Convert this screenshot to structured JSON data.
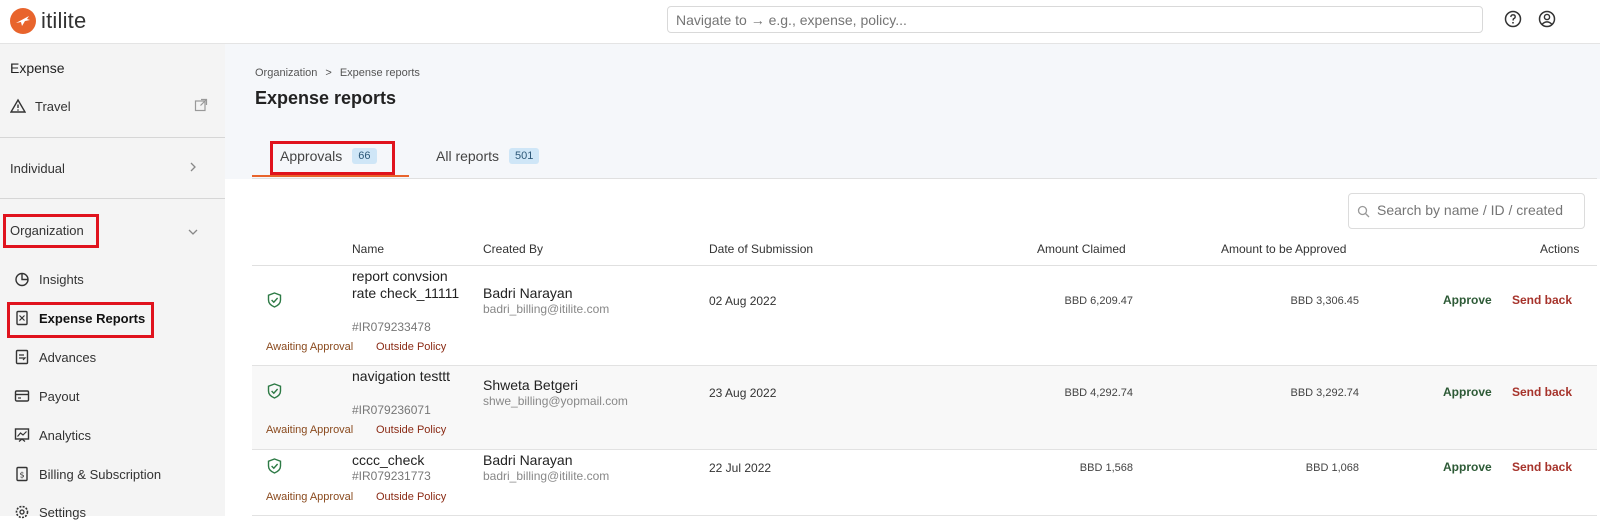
{
  "header": {
    "logo_text": "itilite",
    "nav_placeholder": "Navigate to → e.g., expense, policy...",
    "help_icon": "help-circle-icon",
    "user_icon": "user-circle-icon"
  },
  "sidebar": {
    "section_title": "Expense",
    "travel_label": "Travel",
    "individual_label": "Individual",
    "organization_label": "Organization",
    "items": [
      {
        "label": "Insights",
        "icon": "insights-pie-icon"
      },
      {
        "label": "Expense Reports",
        "icon": "expense-reports-icon"
      },
      {
        "label": "Advances",
        "icon": "advances-icon"
      },
      {
        "label": "Payout",
        "icon": "payout-card-icon"
      },
      {
        "label": "Analytics",
        "icon": "analytics-chart-icon"
      },
      {
        "label": "Billing & Subscription",
        "icon": "billing-icon"
      },
      {
        "label": "Settings",
        "icon": "settings-gear-icon"
      }
    ]
  },
  "main": {
    "breadcrumb": {
      "root": "Organization",
      "separator": ">",
      "current": "Expense reports"
    },
    "title": "Expense reports",
    "tabs": [
      {
        "label": "Approvals",
        "count": "66"
      },
      {
        "label": "All reports",
        "count": "501"
      }
    ],
    "search_placeholder": "Search by name / ID / created",
    "columns": [
      "Name",
      "Created By",
      "Date of Submission",
      "Amount Claimed",
      "Amount to be Approved",
      "Actions"
    ],
    "rows": [
      {
        "name": "report convsion rate check_11111",
        "id": "#IR079233478",
        "creator": "Badri Narayan",
        "email": "badri_billing@itilite.com",
        "date": "02 Aug 2022",
        "claimed": "BBD 6,209.47",
        "to_approve": "BBD 3,306.45",
        "status": "Awaiting Approval",
        "policy": "Outside Policy",
        "approve": "Approve",
        "send_back": "Send back"
      },
      {
        "name": "navigation testtt",
        "id": "#IR079236071",
        "creator": "Shweta Betgeri",
        "email": "shwe_billing@yopmail.com",
        "date": "23 Aug 2022",
        "claimed": "BBD 4,292.74",
        "to_approve": "BBD 3,292.74",
        "status": "Awaiting Approval",
        "policy": "Outside Policy",
        "approve": "Approve",
        "send_back": "Send back"
      },
      {
        "name": "cccc_check",
        "id": "#IR079231773",
        "creator": "Badri Narayan",
        "email": "badri_billing@itilite.com",
        "date": "22 Jul 2022",
        "claimed": "BBD 1,568",
        "to_approve": "BBD 1,068",
        "status": "Awaiting Approval",
        "policy": "Outside Policy",
        "approve": "Approve",
        "send_back": "Send back"
      }
    ]
  },
  "colors": {
    "brand": "#e8642c",
    "highlight": "#e0131d",
    "approve": "#2d5a36",
    "send_back": "#a6332b"
  }
}
